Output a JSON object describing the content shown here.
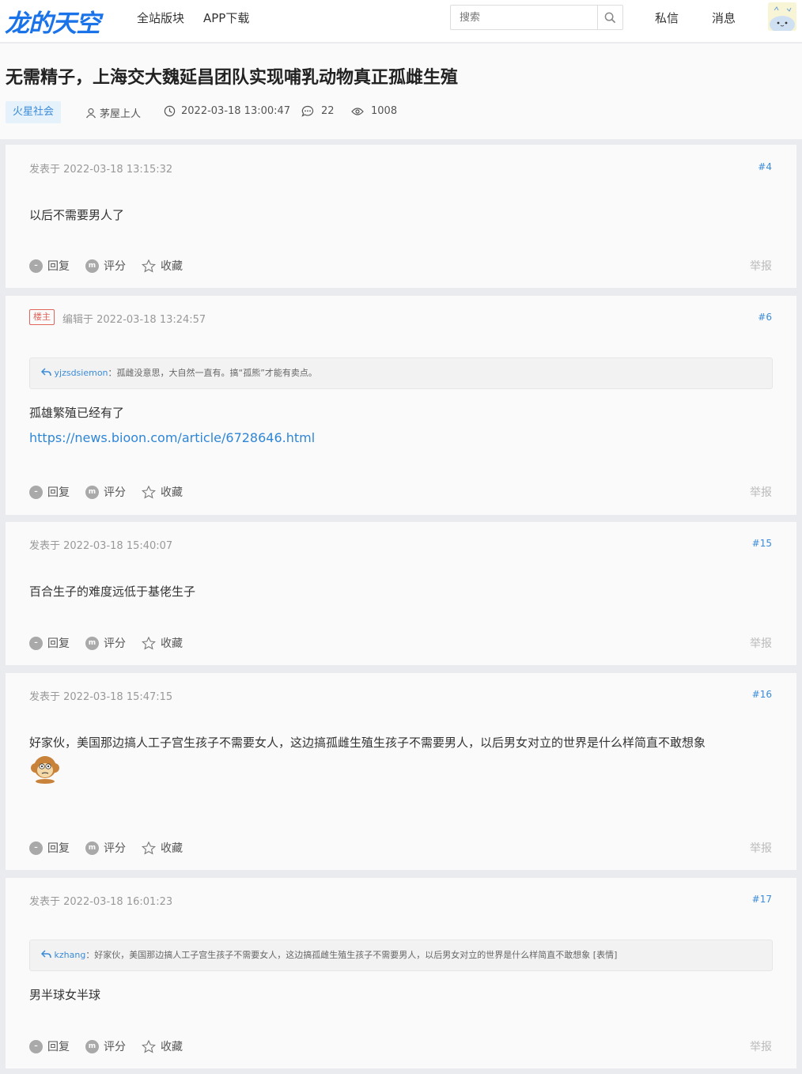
{
  "nav": {
    "logo": "龙的天空",
    "links": [
      "全站版块",
      "APP下载"
    ],
    "search_placeholder": "搜索",
    "right": [
      "私信",
      "消息"
    ]
  },
  "header": {
    "title": "无需精子，上海交大魏延昌团队实现哺乳动物真正孤雌生殖",
    "tag": "火星社会",
    "author": "茅屋上人",
    "datetime": "2022-03-18 13:00:47",
    "comments": "22",
    "views": "1008"
  },
  "actions": {
    "reply": "回复",
    "rate": "评分",
    "favorite": "收藏",
    "report": "举报"
  },
  "posts": [
    {
      "time": "发表于 2022-03-18 13:15:32",
      "floor": "#4",
      "text": "以后不需要男人了"
    },
    {
      "badge": "楼主",
      "time": "编辑于 2022-03-18 13:24:57",
      "floor": "#6",
      "quote_user": "yjzsdsiemon",
      "quote_text": "：孤雌没意思，大自然一直有。搞“孤熊”才能有卖点。",
      "text": "孤雄繁殖已经有了",
      "link": "https://news.bioon.com/article/6728646.html"
    },
    {
      "time": "发表于 2022-03-18 15:40:07",
      "floor": "#15",
      "text": "百合生子的难度远低于基佬生子"
    },
    {
      "time": "发表于 2022-03-18 15:47:15",
      "floor": "#16",
      "text": "好家伙，美国那边搞人工子宫生孩子不需要女人，这边搞孤雌生殖生孩子不需要男人，以后男女对立的世界是什么样简直不敢想象"
    },
    {
      "time": "发表于 2022-03-18 16:01:23",
      "floor": "#17",
      "quote_user": "kzhang",
      "quote_text": "：好家伙，美国那边搞人工子宫生孩子不需要女人，这边搞孤雌生殖生孩子不需要男人，以后男女对立的世界是什么样简直不敢想象 [表情]",
      "text": "男半球女半球"
    }
  ]
}
